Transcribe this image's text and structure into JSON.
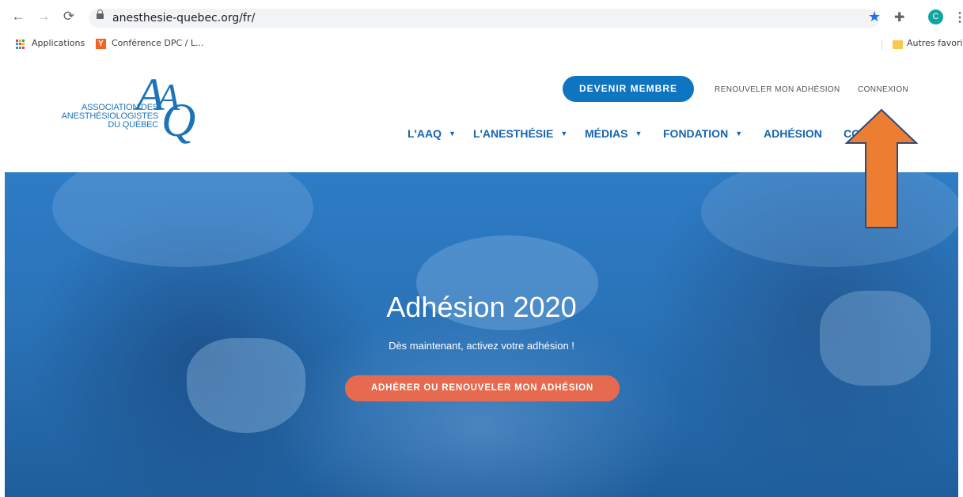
{
  "browser": {
    "url": "anesthesie-quebec.org/fr/",
    "profile_initial": "C",
    "bookmarks": {
      "apps_label": "Applications",
      "item1": "Conférence DPC / L...",
      "other": "Autres favori"
    }
  },
  "site": {
    "logo": {
      "letters": "AAQ",
      "line1": "ASSOCIATION DES",
      "line2": "ANESTHÉSIOLOGISTES",
      "line3": "DU QUÉBEC"
    },
    "top_bar": {
      "member_button": "DEVENIR MEMBRE",
      "renew_link": "RENOUVELER MON ADHÉSION",
      "login_link": "CONNEXION"
    },
    "nav": {
      "aaq": "L'AAQ",
      "anesthesie": "L'ANESTHÉSIE",
      "medias": "MÉDIAS",
      "fondation": "FONDATION",
      "adhesion": "ADHÉSION",
      "partial": "CO"
    }
  },
  "hero": {
    "title": "Adhésion 2020",
    "subtitle": "Dès maintenant, activez votre adhésion !",
    "cta": "ADHÉRER OU RENOUVELER MON ADHÉSION"
  },
  "colors": {
    "brand_blue": "#1075c1",
    "cta_orange": "#e66a4f",
    "arrow_orange": "#ed7d31",
    "arrow_border": "#2f4a7c"
  }
}
